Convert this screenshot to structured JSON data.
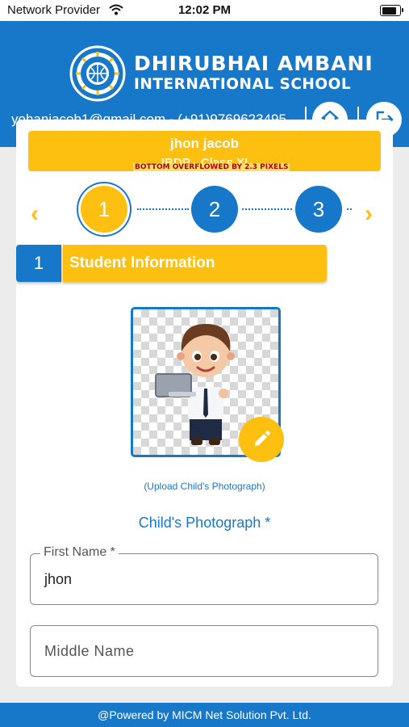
{
  "status_bar": {
    "carrier": "Network Provider",
    "time": "12:02 PM"
  },
  "header": {
    "school_line1": "DHIRUBHAI AMBANI",
    "school_line2": "INTERNATIONAL SCHOOL",
    "contact": "yohanjacob1@gmail.com - (+91)9769623495",
    "home_icon": "home-icon",
    "logout_icon": "logout-icon"
  },
  "student": {
    "name": "jhon  jacob",
    "class": "IBDP - Class XI"
  },
  "overflow_warning": "BOTTOM OVERFLOWED BY 2.3 PIXELS",
  "stepper": {
    "steps": [
      "1",
      "2",
      "3"
    ],
    "active": "1"
  },
  "section": {
    "number": "1",
    "title": "Student Information"
  },
  "photo": {
    "upload_hint": "(Upload Child's Photograph)",
    "label": "Child's Photograph *",
    "edit_icon": "pencil-icon"
  },
  "form": {
    "first_name": {
      "label": "First Name *",
      "value": "jhon"
    },
    "middle_name": {
      "placeholder": "Middle Name"
    }
  },
  "footer": {
    "text": "@Powered by MICM Net Solution Pvt. Ltd."
  },
  "colors": {
    "primary": "#1778c9",
    "accent": "#fdbf10"
  }
}
